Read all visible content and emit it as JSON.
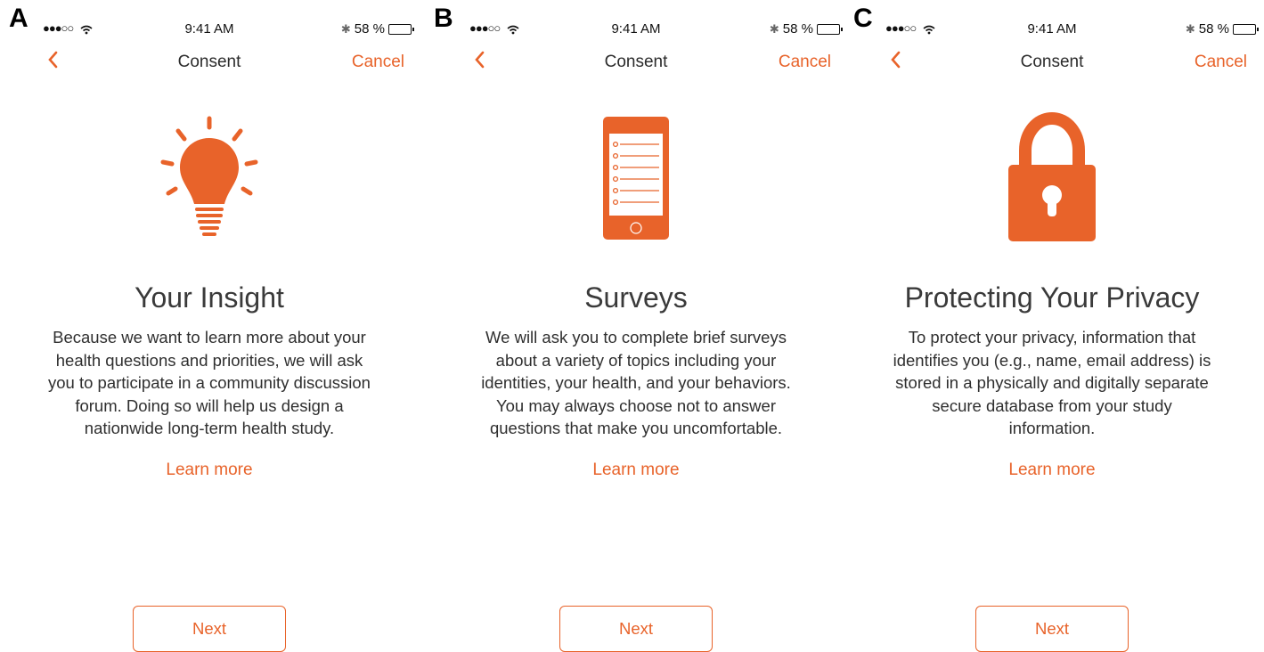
{
  "accent": "#e8632a",
  "panels": [
    {
      "letter": "A",
      "status": {
        "time": "9:41 AM",
        "battery": "58 %",
        "battery_level": 0.58
      },
      "nav": {
        "title": "Consent",
        "cancel": "Cancel"
      },
      "icon": "lightbulb-icon",
      "headline": "Your Insight",
      "body": "Because we want to learn more about your health questions and priorities, we will ask you to participate in a community discussion forum. Doing so will help us design a nationwide long-term health study.",
      "learn_more": "Learn more",
      "next": "Next"
    },
    {
      "letter": "B",
      "status": {
        "time": "9:41 AM",
        "battery": "58 %",
        "battery_level": 0.58
      },
      "nav": {
        "title": "Consent",
        "cancel": "Cancel"
      },
      "icon": "phone-survey-icon",
      "headline": "Surveys",
      "body": "We will ask you to complete brief surveys about a variety of topics including your identities, your health, and your behaviors. You may always choose not to answer questions that make you uncomfortable.",
      "learn_more": "Learn more",
      "next": "Next"
    },
    {
      "letter": "C",
      "status": {
        "time": "9:41 AM",
        "battery": "58 %",
        "battery_level": 0.58
      },
      "nav": {
        "title": "Consent",
        "cancel": "Cancel"
      },
      "icon": "padlock-icon",
      "headline": "Protecting Your Privacy",
      "body": "To protect your privacy, information that identifies you (e.g., name, email address) is stored in a physically and digitally separate secure database from your study information.",
      "learn_more": "Learn more",
      "next": "Next"
    }
  ]
}
